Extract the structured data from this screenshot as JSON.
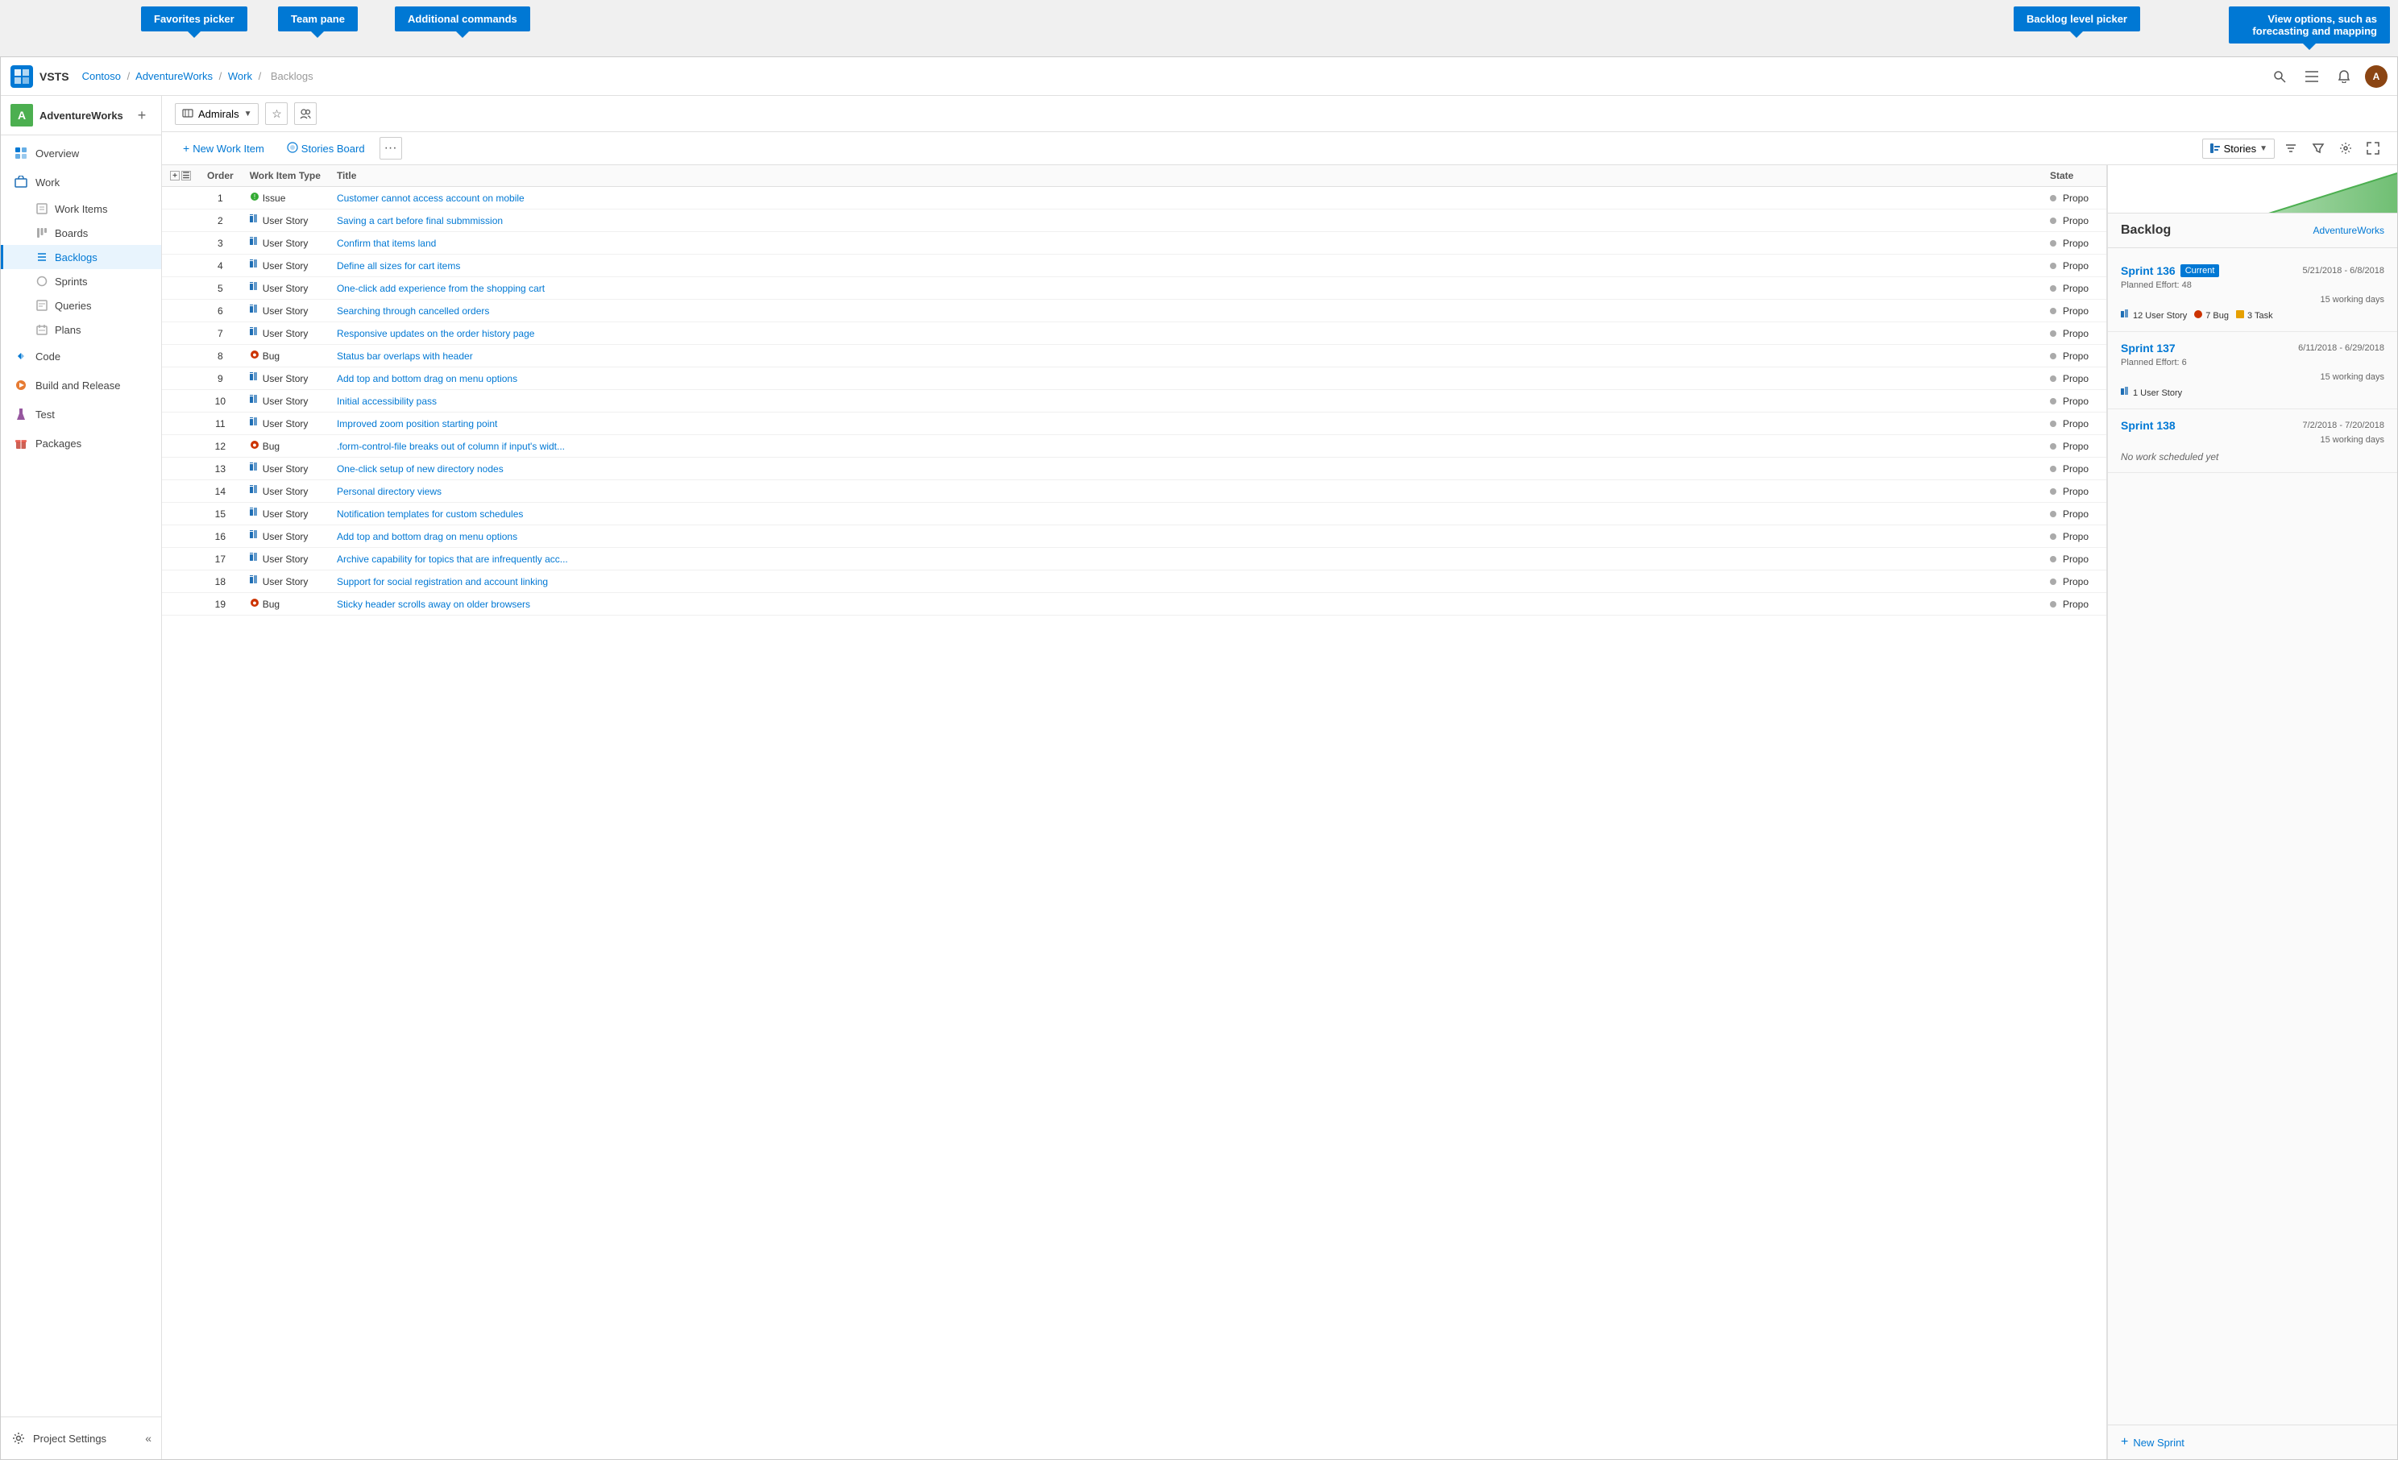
{
  "tooltips": {
    "favorites_picker": "Favorites picker",
    "team_pane": "Team pane",
    "additional_commands": "Additional commands",
    "backlog_level_picker": "Backlog level picker",
    "view_options": "View options, such as forecasting and mapping"
  },
  "top_nav": {
    "logo_text": "V",
    "app_name": "VSTS",
    "breadcrumb": [
      {
        "label": "Contoso",
        "href": "#"
      },
      {
        "label": "AdventureWorks",
        "href": "#"
      },
      {
        "label": "Work",
        "href": "#"
      },
      {
        "label": "Backlogs",
        "href": "#",
        "current": true
      }
    ]
  },
  "sidebar": {
    "project": {
      "name": "AdventureWorks",
      "initials": "A"
    },
    "nav_items": [
      {
        "id": "overview",
        "label": "Overview",
        "icon": "🏠"
      },
      {
        "id": "work",
        "label": "Work",
        "icon": "⚙",
        "active": false,
        "has_children": true
      },
      {
        "id": "work-items",
        "label": "Work Items",
        "icon": "📋",
        "sub": true
      },
      {
        "id": "boards",
        "label": "Boards",
        "icon": "⊞",
        "sub": true
      },
      {
        "id": "backlogs",
        "label": "Backlogs",
        "icon": "☰",
        "sub": true,
        "active": true
      },
      {
        "id": "sprints",
        "label": "Sprints",
        "icon": "◯",
        "sub": true
      },
      {
        "id": "queries",
        "label": "Queries",
        "icon": "≡",
        "sub": true
      },
      {
        "id": "plans",
        "label": "Plans",
        "icon": "📅",
        "sub": true
      },
      {
        "id": "code",
        "label": "Code",
        "icon": "🔷"
      },
      {
        "id": "build-release",
        "label": "Build and Release",
        "icon": "🚀"
      },
      {
        "id": "test",
        "label": "Test",
        "icon": "🧪"
      },
      {
        "id": "packages",
        "label": "Packages",
        "icon": "📦"
      }
    ],
    "footer": {
      "settings_label": "Project Settings"
    }
  },
  "toolbar": {
    "team_name": "Admirals",
    "new_work_item_label": "New Work Item",
    "stories_board_label": "Stories Board",
    "stories_label": "Stories"
  },
  "table": {
    "columns": [
      "",
      "Order",
      "Work Item Type",
      "Title",
      "State"
    ],
    "rows": [
      {
        "order": 1,
        "type": "Issue",
        "icon": "🌿",
        "title": "Customer cannot access account on mobile",
        "state": "Propo"
      },
      {
        "order": 2,
        "type": "User Story",
        "icon": "📊",
        "title": "Saving a cart before final submmission",
        "state": "Propo"
      },
      {
        "order": 3,
        "type": "User Story",
        "icon": "📊",
        "title": "Confirm that items land",
        "state": "Propo"
      },
      {
        "order": 4,
        "type": "User Story",
        "icon": "📊",
        "title": "Define all sizes for cart items",
        "state": "Propo"
      },
      {
        "order": 5,
        "type": "User Story",
        "icon": "📊",
        "title": "One-click add experience from the shopping cart",
        "state": "Propo"
      },
      {
        "order": 6,
        "type": "User Story",
        "icon": "📊",
        "title": "Searching through cancelled orders",
        "state": "Propo"
      },
      {
        "order": 7,
        "type": "User Story",
        "icon": "📊",
        "title": "Responsive updates on the order history page",
        "state": "Propo"
      },
      {
        "order": 8,
        "type": "Bug",
        "icon": "🐛",
        "title": "Status bar overlaps with header",
        "state": "Propo"
      },
      {
        "order": 9,
        "type": "User Story",
        "icon": "📊",
        "title": "Add top and bottom drag on menu options",
        "state": "Propo"
      },
      {
        "order": 10,
        "type": "User Story",
        "icon": "📊",
        "title": "Initial accessibility pass",
        "state": "Propo"
      },
      {
        "order": 11,
        "type": "User Story",
        "icon": "📊",
        "title": "Improved zoom position starting point",
        "state": "Propo"
      },
      {
        "order": 12,
        "type": "Bug",
        "icon": "🐛",
        "title": ".form-control-file breaks out of column if input's widt...",
        "state": "Propo"
      },
      {
        "order": 13,
        "type": "User Story",
        "icon": "📊",
        "title": "One-click setup of new directory nodes",
        "state": "Propo"
      },
      {
        "order": 14,
        "type": "User Story",
        "icon": "📊",
        "title": "Personal directory views",
        "state": "Propo"
      },
      {
        "order": 15,
        "type": "User Story",
        "icon": "📊",
        "title": "Notification templates for custom schedules",
        "state": "Propo"
      },
      {
        "order": 16,
        "type": "User Story",
        "icon": "📊",
        "title": "Add top and bottom drag on menu options",
        "state": "Propo"
      },
      {
        "order": 17,
        "type": "User Story",
        "icon": "📊",
        "title": "Archive capability for topics that are infrequently acc...",
        "state": "Propo"
      },
      {
        "order": 18,
        "type": "User Story",
        "icon": "📊",
        "title": "Support for social registration and account linking",
        "state": "Propo"
      },
      {
        "order": 19,
        "type": "Bug",
        "icon": "🐛",
        "title": "Sticky header scrolls away on older browsers",
        "state": "Propo"
      }
    ]
  },
  "backlog_panel": {
    "title": "Backlog",
    "subtitle": "AdventureWorks",
    "sprints": [
      {
        "id": "sprint136",
        "name": "Sprint 136",
        "badge": "Current",
        "date_range": "5/21/2018 - 6/8/2018",
        "planned_effort": 48,
        "working_days": "15 working days",
        "tags": [
          {
            "icon": "story",
            "count": 12,
            "label": "User Story"
          },
          {
            "icon": "bug",
            "count": 7,
            "label": "Bug"
          },
          {
            "icon": "task",
            "count": 3,
            "label": "Task"
          }
        ]
      },
      {
        "id": "sprint137",
        "name": "Sprint 137",
        "badge": null,
        "date_range": "6/11/2018 - 6/29/2018",
        "planned_effort": 6,
        "working_days": "15 working days",
        "tags": [
          {
            "icon": "story",
            "count": 1,
            "label": "User Story"
          }
        ]
      },
      {
        "id": "sprint138",
        "name": "Sprint 138",
        "badge": null,
        "date_range": "7/2/2018 - 7/20/2018",
        "planned_effort": null,
        "working_days": "15 working days",
        "no_work": "No work scheduled yet",
        "tags": []
      }
    ],
    "new_sprint_label": "+ New Sprint"
  }
}
